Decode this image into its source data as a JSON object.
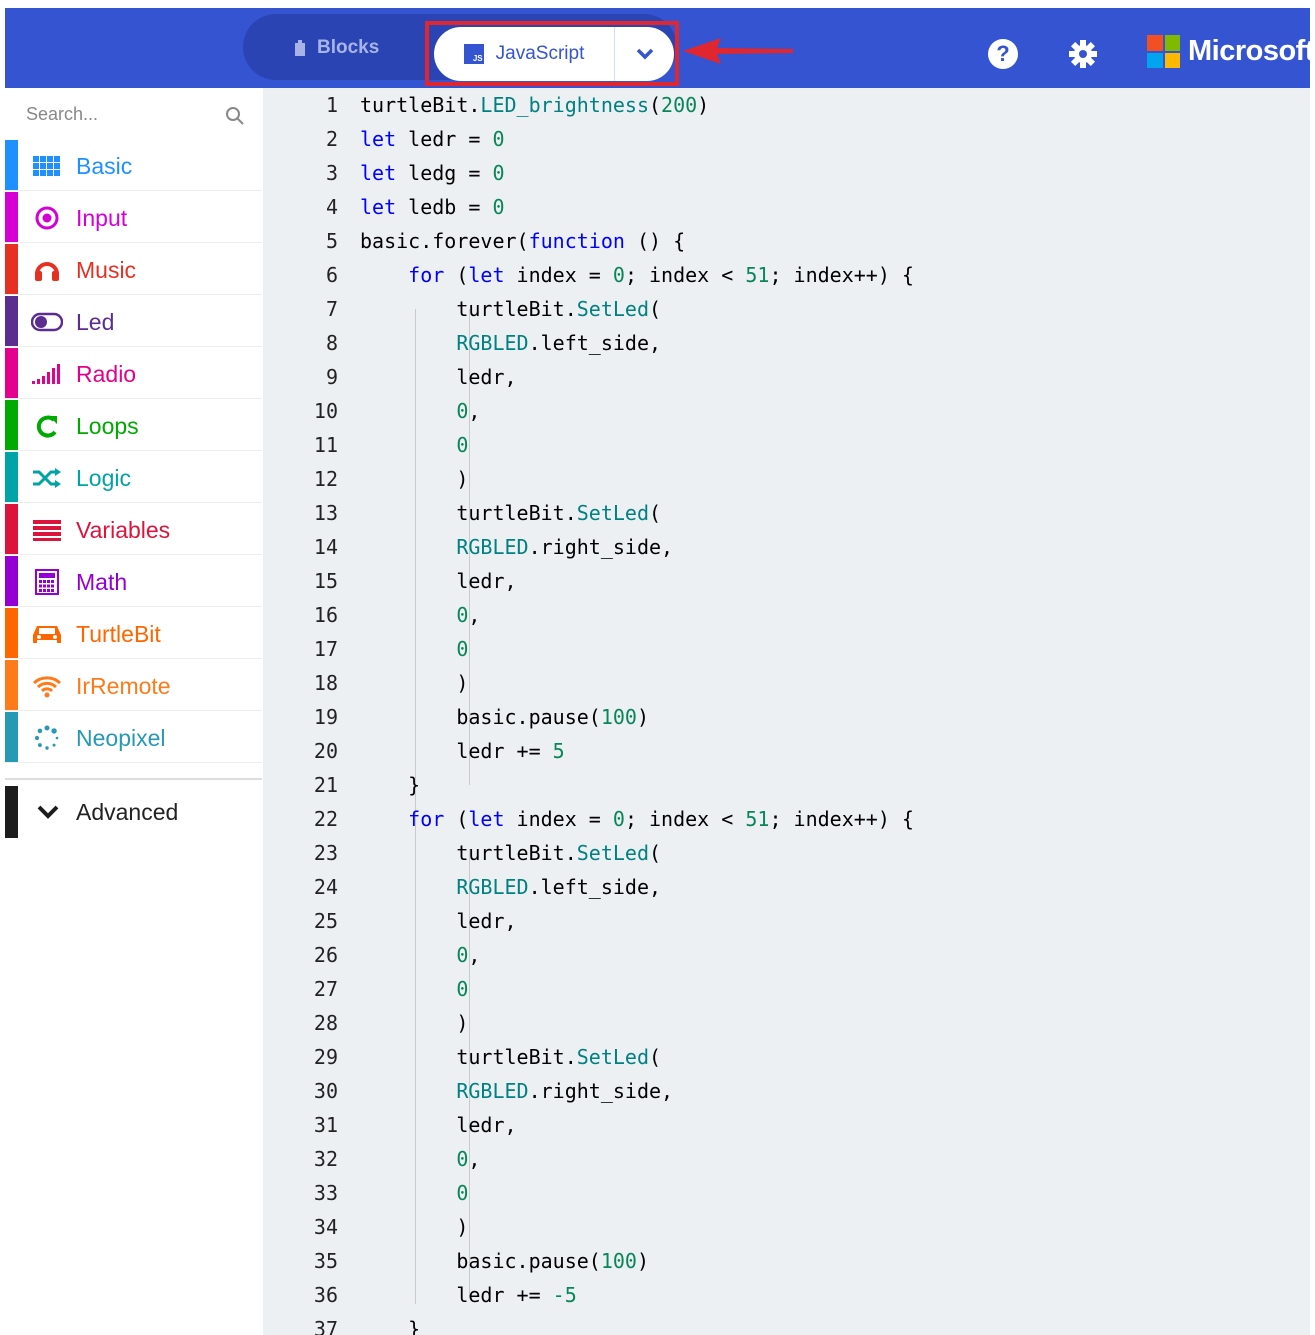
{
  "header": {
    "blocks_label": "Blocks",
    "javascript_label": "JavaScript",
    "js_badge": "JS",
    "brand": "Microsoft",
    "colors": {
      "bar": "#3454d1",
      "pill": "#2a44b3",
      "highlight": "#e0262e"
    }
  },
  "sidebar": {
    "search_placeholder": "Search...",
    "categories": [
      {
        "label": "Basic",
        "color": "#1e90ff",
        "icon": "grid-icon"
      },
      {
        "label": "Input",
        "color": "#d400d4",
        "icon": "radio-button-icon"
      },
      {
        "label": "Music",
        "color": "#e63022",
        "icon": "headphones-icon"
      },
      {
        "label": "Led",
        "color": "#5c2d91",
        "icon": "toggle-icon"
      },
      {
        "label": "Radio",
        "color": "#e3008c",
        "icon": "signal-bars-icon"
      },
      {
        "label": "Loops",
        "color": "#00aa00",
        "icon": "refresh-icon"
      },
      {
        "label": "Logic",
        "color": "#00a4a6",
        "icon": "shuffle-icon"
      },
      {
        "label": "Variables",
        "color": "#dc143c",
        "icon": "list-icon"
      },
      {
        "label": "Math",
        "color": "#9400d3",
        "icon": "calculator-icon"
      },
      {
        "label": "TurtleBit",
        "color": "#ff6600",
        "icon": "car-icon"
      },
      {
        "label": "IrRemote",
        "color": "#ff7a1a",
        "icon": "wifi-icon"
      },
      {
        "label": "Neopixel",
        "color": "#2699b4",
        "icon": "spinner-icon"
      }
    ],
    "advanced_label": "Advanced"
  },
  "editor": {
    "colors": {
      "keyword": "#0000ff",
      "api": "#008080",
      "number": "#098658",
      "text": "#000000"
    },
    "lines": [
      {
        "n": "1",
        "parts": [
          [
            "turtleBit.",
            "t"
          ],
          [
            "LED_brightness",
            "a"
          ],
          [
            "(",
            "t"
          ],
          [
            "200",
            "n"
          ],
          [
            ")",
            "t"
          ]
        ]
      },
      {
        "n": "2",
        "parts": [
          [
            "let",
            "k"
          ],
          [
            " ledr = ",
            "t"
          ],
          [
            "0",
            "n"
          ]
        ]
      },
      {
        "n": "3",
        "parts": [
          [
            "let",
            "k"
          ],
          [
            " ledg = ",
            "t"
          ],
          [
            "0",
            "n"
          ]
        ]
      },
      {
        "n": "4",
        "parts": [
          [
            "let",
            "k"
          ],
          [
            " ledb = ",
            "t"
          ],
          [
            "0",
            "n"
          ]
        ]
      },
      {
        "n": "5",
        "parts": [
          [
            "basic.forever(",
            "t"
          ],
          [
            "function",
            "k"
          ],
          [
            " () {",
            "t"
          ]
        ]
      },
      {
        "n": "6",
        "parts": [
          [
            "    ",
            "t"
          ],
          [
            "for",
            "k"
          ],
          [
            " (",
            "t"
          ],
          [
            "let",
            "k"
          ],
          [
            " index = ",
            "t"
          ],
          [
            "0",
            "n"
          ],
          [
            "; index < ",
            "t"
          ],
          [
            "51",
            "n"
          ],
          [
            "; index++) {",
            "t"
          ]
        ]
      },
      {
        "n": "7",
        "parts": [
          [
            "        turtleBit.",
            "t"
          ],
          [
            "SetLed",
            "a"
          ],
          [
            "(",
            "t"
          ]
        ]
      },
      {
        "n": "8",
        "parts": [
          [
            "        ",
            "t"
          ],
          [
            "RGBLED",
            "a"
          ],
          [
            ".left_side,",
            "t"
          ]
        ]
      },
      {
        "n": "9",
        "parts": [
          [
            "        ledr,",
            "t"
          ]
        ]
      },
      {
        "n": "10",
        "parts": [
          [
            "        ",
            "t"
          ],
          [
            "0",
            "n"
          ],
          [
            ",",
            "t"
          ]
        ]
      },
      {
        "n": "11",
        "parts": [
          [
            "        ",
            "t"
          ],
          [
            "0",
            "n"
          ]
        ]
      },
      {
        "n": "12",
        "parts": [
          [
            "        )",
            "t"
          ]
        ]
      },
      {
        "n": "13",
        "parts": [
          [
            "        turtleBit.",
            "t"
          ],
          [
            "SetLed",
            "a"
          ],
          [
            "(",
            "t"
          ]
        ]
      },
      {
        "n": "14",
        "parts": [
          [
            "        ",
            "t"
          ],
          [
            "RGBLED",
            "a"
          ],
          [
            ".right_side,",
            "t"
          ]
        ]
      },
      {
        "n": "15",
        "parts": [
          [
            "        ledr,",
            "t"
          ]
        ]
      },
      {
        "n": "16",
        "parts": [
          [
            "        ",
            "t"
          ],
          [
            "0",
            "n"
          ],
          [
            ",",
            "t"
          ]
        ]
      },
      {
        "n": "17",
        "parts": [
          [
            "        ",
            "t"
          ],
          [
            "0",
            "n"
          ]
        ]
      },
      {
        "n": "18",
        "parts": [
          [
            "        )",
            "t"
          ]
        ]
      },
      {
        "n": "19",
        "parts": [
          [
            "        basic.pause(",
            "t"
          ],
          [
            "100",
            "n"
          ],
          [
            ")",
            "t"
          ]
        ]
      },
      {
        "n": "20",
        "parts": [
          [
            "        ledr += ",
            "t"
          ],
          [
            "5",
            "n"
          ]
        ]
      },
      {
        "n": "21",
        "parts": [
          [
            "    }",
            "t"
          ]
        ]
      },
      {
        "n": "22",
        "parts": [
          [
            "    ",
            "t"
          ],
          [
            "for",
            "k"
          ],
          [
            " (",
            "t"
          ],
          [
            "let",
            "k"
          ],
          [
            " index = ",
            "t"
          ],
          [
            "0",
            "n"
          ],
          [
            "; index < ",
            "t"
          ],
          [
            "51",
            "n"
          ],
          [
            "; index++) {",
            "t"
          ]
        ]
      },
      {
        "n": "23",
        "parts": [
          [
            "        turtleBit.",
            "t"
          ],
          [
            "SetLed",
            "a"
          ],
          [
            "(",
            "t"
          ]
        ]
      },
      {
        "n": "24",
        "parts": [
          [
            "        ",
            "t"
          ],
          [
            "RGBLED",
            "a"
          ],
          [
            ".left_side,",
            "t"
          ]
        ]
      },
      {
        "n": "25",
        "parts": [
          [
            "        ledr,",
            "t"
          ]
        ]
      },
      {
        "n": "26",
        "parts": [
          [
            "        ",
            "t"
          ],
          [
            "0",
            "n"
          ],
          [
            ",",
            "t"
          ]
        ]
      },
      {
        "n": "27",
        "parts": [
          [
            "        ",
            "t"
          ],
          [
            "0",
            "n"
          ]
        ]
      },
      {
        "n": "28",
        "parts": [
          [
            "        )",
            "t"
          ]
        ]
      },
      {
        "n": "29",
        "parts": [
          [
            "        turtleBit.",
            "t"
          ],
          [
            "SetLed",
            "a"
          ],
          [
            "(",
            "t"
          ]
        ]
      },
      {
        "n": "30",
        "parts": [
          [
            "        ",
            "t"
          ],
          [
            "RGBLED",
            "a"
          ],
          [
            ".right_side,",
            "t"
          ]
        ]
      },
      {
        "n": "31",
        "parts": [
          [
            "        ledr,",
            "t"
          ]
        ]
      },
      {
        "n": "32",
        "parts": [
          [
            "        ",
            "t"
          ],
          [
            "0",
            "n"
          ],
          [
            ",",
            "t"
          ]
        ]
      },
      {
        "n": "33",
        "parts": [
          [
            "        ",
            "t"
          ],
          [
            "0",
            "n"
          ]
        ]
      },
      {
        "n": "34",
        "parts": [
          [
            "        )",
            "t"
          ]
        ]
      },
      {
        "n": "35",
        "parts": [
          [
            "        basic.pause(",
            "t"
          ],
          [
            "100",
            "n"
          ],
          [
            ")",
            "t"
          ]
        ]
      },
      {
        "n": "36",
        "parts": [
          [
            "        ledr += ",
            "t"
          ],
          [
            "-5",
            "n"
          ]
        ]
      },
      {
        "n": "37",
        "parts": [
          [
            "    }",
            "t"
          ]
        ]
      }
    ]
  }
}
